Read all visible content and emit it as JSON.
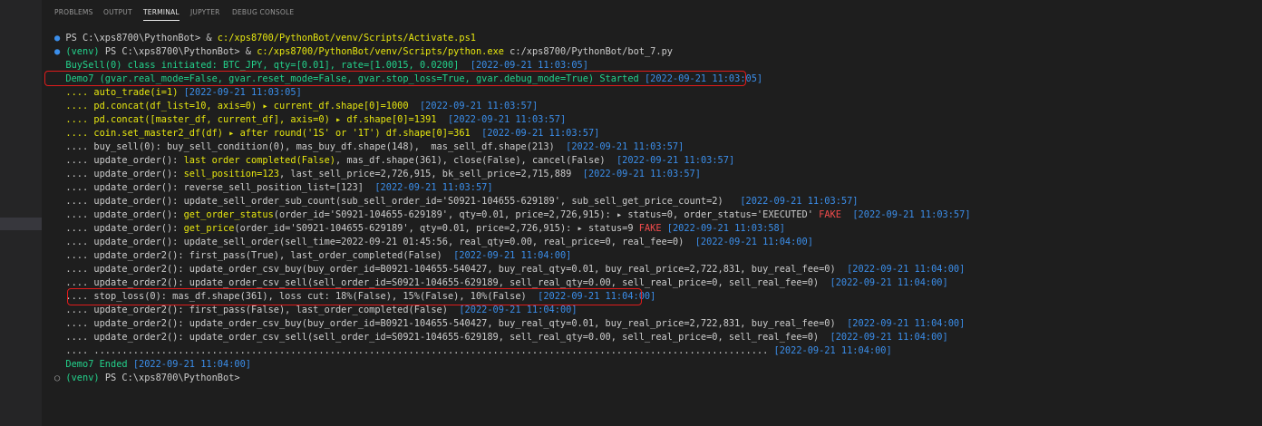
{
  "tabs": [
    "PROBLEMS",
    "OUTPUT",
    "TERMINAL",
    "JUPYTER",
    "DEBUG CONSOLE"
  ],
  "active_tab": "TERMINAL",
  "lines": [
    [
      [
        "b",
        "● "
      ],
      [
        "w",
        "PS C:\\xps8700\\PythonBot> & "
      ],
      [
        "y",
        "c:/xps8700/PythonBot/venv/Scripts/Activate.ps1"
      ]
    ],
    [
      [
        "b",
        "● "
      ],
      [
        "g",
        "(venv) "
      ],
      [
        "w",
        "PS C:\\xps8700\\PythonBot> & "
      ],
      [
        "y",
        "c:/xps8700/PythonBot/venv/Scripts/python.exe"
      ],
      [
        "w",
        " c:/xps8700/PythonBot/bot_7.py"
      ]
    ],
    [
      [
        "w",
        "  "
      ],
      [
        "g",
        "BuySell(0) class initiated: BTC_JPY, qty=[0.01], rate=[1.0015, 0.0200]  "
      ],
      [
        "b",
        "[2022-09-21 11:03:05]"
      ]
    ],
    [
      [
        "w",
        "  "
      ],
      [
        "g",
        "Demo7 (gvar.real_mode=False, gvar.reset_mode=False, gvar.stop_loss=True, gvar.debug_mode=True) Started "
      ],
      [
        "b",
        "[2022-09-21 11:03:05]"
      ]
    ],
    [
      [
        "w",
        "  "
      ],
      [
        "y",
        ".... auto_trade(i=1) "
      ],
      [
        "b",
        "[2022-09-21 11:03:05]"
      ]
    ],
    [
      [
        "w",
        "  "
      ],
      [
        "y",
        ".... pd.concat(df_list=10, axis=0) ▸ current_df.shape[0]=1000  "
      ],
      [
        "b",
        "[2022-09-21 11:03:57]"
      ]
    ],
    [
      [
        "w",
        "  "
      ],
      [
        "y",
        ".... pd.concat([master_df, current_df], axis=0) ▸ df.shape[0]=1391  "
      ],
      [
        "b",
        "[2022-09-21 11:03:57]"
      ]
    ],
    [
      [
        "w",
        "  "
      ],
      [
        "y",
        ".... coin.set_master2_df(df) ▸ after round('1S' or '1T') df.shape[0]=361  "
      ],
      [
        "b",
        "[2022-09-21 11:03:57]"
      ]
    ],
    [
      [
        "w",
        "  .... buy_sell(0): buy_sell_condition(0), mas_buy_df.shape(148),  mas_sell_df.shape(213)  "
      ],
      [
        "b",
        "[2022-09-21 11:03:57]"
      ]
    ],
    [
      [
        "w",
        "  .... update_order(): "
      ],
      [
        "y",
        "last order completed(False)"
      ],
      [
        "w",
        ", mas_df.shape(361), close(False), cancel(False)  "
      ],
      [
        "b",
        "[2022-09-21 11:03:57]"
      ]
    ],
    [
      [
        "w",
        "  .... update_order(): "
      ],
      [
        "y",
        "sell_position=123"
      ],
      [
        "w",
        ", last_sell_price=2,726,915, bk_sell_price=2,715,889  "
      ],
      [
        "b",
        "[2022-09-21 11:03:57]"
      ]
    ],
    [
      [
        "w",
        "  .... update_order(): reverse_sell_position_list=[123]  "
      ],
      [
        "b",
        "[2022-09-21 11:03:57]"
      ]
    ],
    [
      [
        "w",
        "  .... update_order(): update_sell_order_sub_count(sub_sell_order_id='S0921-104655-629189', sub_sell_get_price_count=2)   "
      ],
      [
        "b",
        "[2022-09-21 11:03:57]"
      ]
    ],
    [
      [
        "w",
        "  .... update_order(): "
      ],
      [
        "y",
        "get_order_status"
      ],
      [
        "w",
        "(order_id='S0921-104655-629189', qty=0.01, price=2,726,915): ▸ status=0, order_status='EXECUTED' "
      ],
      [
        "r",
        "FAKE"
      ],
      [
        "w",
        "  "
      ],
      [
        "b",
        "[2022-09-21 11:03:57]"
      ]
    ],
    [
      [
        "w",
        "  .... update_order(): "
      ],
      [
        "y",
        "get_price"
      ],
      [
        "w",
        "(order_id='S0921-104655-629189', qty=0.01, price=2,726,915): ▸ status=9 "
      ],
      [
        "r",
        "FAKE"
      ],
      [
        "w",
        " "
      ],
      [
        "b",
        "[2022-09-21 11:03:58]"
      ]
    ],
    [
      [
        "w",
        "  .... update_order(): update_sell_order(sell_time=2022-09-21 01:45:56, real_qty=0.00, real_price=0, real_fee=0)  "
      ],
      [
        "b",
        "[2022-09-21 11:04:00]"
      ]
    ],
    [
      [
        "w",
        "  .... update_order2(): first_pass(True), last_order_completed(False)  "
      ],
      [
        "b",
        "[2022-09-21 11:04:00]"
      ]
    ],
    [
      [
        "w",
        "  .... update_order2(): update_order_csv_buy(buy_order_id=B0921-104655-540427, buy_real_qty=0.01, buy_real_price=2,722,831, buy_real_fee=0)  "
      ],
      [
        "b",
        "[2022-09-21 11:04:00]"
      ]
    ],
    [
      [
        "w",
        "  .... update_order2(): update_order_csv_sell(sell_order_id=S0921-104655-629189, sell_real_qty=0.00, sell_real_price=0, sell_real_fee=0)  "
      ],
      [
        "b",
        "[2022-09-21 11:04:00]"
      ]
    ],
    [
      [
        "w",
        "  .... stop_loss(0): mas_df.shape(361), loss cut: 18%(False), 15%(False), 10%(False)  "
      ],
      [
        "b",
        "[2022-09-21 11:04:00]"
      ]
    ],
    [
      [
        "w",
        "  .... update_order2(): first_pass(False), last_order_completed(False)  "
      ],
      [
        "b",
        "[2022-09-21 11:04:00]"
      ]
    ],
    [
      [
        "w",
        "  .... update_order2(): update_order_csv_buy(buy_order_id=B0921-104655-540427, buy_real_qty=0.01, buy_real_price=2,722,831, buy_real_fee=0)  "
      ],
      [
        "b",
        "[2022-09-21 11:04:00]"
      ]
    ],
    [
      [
        "w",
        "  .... update_order2(): update_order_csv_sell(sell_order_id=S0921-104655-629189, sell_real_qty=0.00, sell_real_price=0, sell_real_fee=0)  "
      ],
      [
        "b",
        "[2022-09-21 11:04:00]"
      ]
    ],
    [
      [
        "w",
        "  .... ........................................................................................................................ "
      ],
      [
        "b",
        "[2022-09-21 11:04:00]"
      ]
    ],
    [
      [
        "w",
        "  "
      ],
      [
        "g",
        "Demo7 Ended "
      ],
      [
        "b",
        "[2022-09-21 11:04:00]"
      ]
    ],
    [
      [
        "dim",
        "○ "
      ],
      [
        "g",
        "(venv) "
      ],
      [
        "w",
        "PS C:\\xps8700\\PythonBot>"
      ]
    ]
  ]
}
